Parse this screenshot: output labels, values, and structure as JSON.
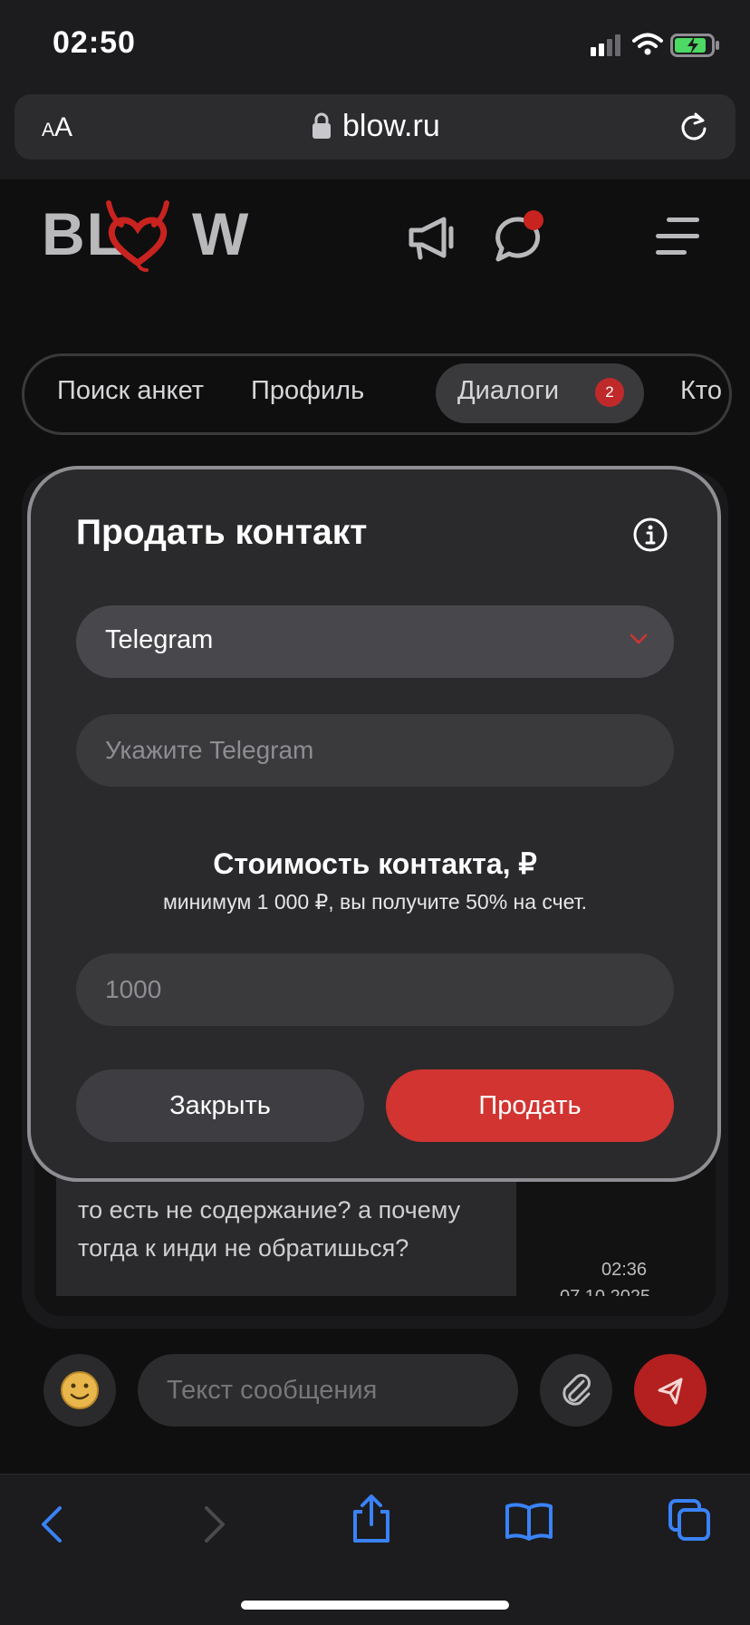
{
  "status_bar": {
    "time": "02:50"
  },
  "browser": {
    "aa_small": "A",
    "aa_big": "A",
    "url": "blow.ru"
  },
  "site": {
    "logo_left": "BL",
    "logo_right": "W",
    "tabs": [
      {
        "label": "Поиск анкет"
      },
      {
        "label": "Профиль"
      },
      {
        "label": "Диалоги",
        "badge": "2"
      },
      {
        "label": "Кто"
      }
    ]
  },
  "chat": {
    "message_text": "то есть не содержание? а почему тогда к инди не обратишься?",
    "message_time": "02:36",
    "message_date": "07.10.2025"
  },
  "composer": {
    "placeholder": "Текст сообщения"
  },
  "modal": {
    "title": "Продать контакт",
    "select_value": "Telegram",
    "contact_placeholder": "Укажите Telegram",
    "price_title": "Стоимость контакта, ₽",
    "price_subtitle": "минимум 1 000 ₽, вы получите 50% на счет.",
    "price_placeholder": "1000",
    "close_label": "Закрыть",
    "sell_label": "Продать"
  },
  "colors": {
    "accent": "#d23431",
    "badge": "#c0292a",
    "modal_bg": "#2a2a2c"
  }
}
